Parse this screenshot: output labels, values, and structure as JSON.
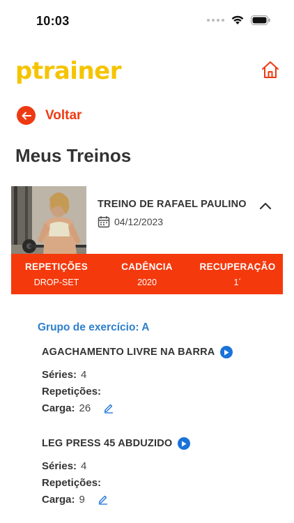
{
  "status": {
    "time": "10:03"
  },
  "header": {
    "logo": "ptrainer"
  },
  "nav": {
    "back_label": "Voltar"
  },
  "page": {
    "title": "Meus Treinos"
  },
  "card": {
    "title": "TREINO DE RAFAEL PAULINO",
    "date": "04/12/2023"
  },
  "stats": [
    {
      "label": "REPETIÇÕES",
      "value": "DROP-SET"
    },
    {
      "label": "CADÊNCIA",
      "value": "2020"
    },
    {
      "label": "RECUPERAÇÃO",
      "value": "1´"
    }
  ],
  "group": {
    "title": "Grupo de exercício: A"
  },
  "labels": {
    "series": "Séries:",
    "reps": "Repetições:",
    "load": "Carga:"
  },
  "exercises": [
    {
      "name": "AGACHAMENTO LIVRE NA BARRA",
      "series": "4",
      "reps": "",
      "load": "26"
    },
    {
      "name": "LEG PRESS 45 ABDUZIDO",
      "series": "4",
      "reps": "",
      "load": "9"
    }
  ],
  "colors": {
    "accent": "#ee3a12",
    "brand_yellow": "#f5c400",
    "link_blue": "#2d7fcc"
  }
}
